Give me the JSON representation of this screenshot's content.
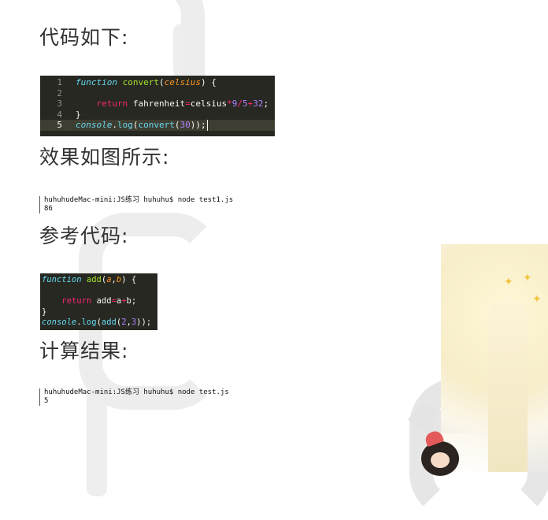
{
  "headings": {
    "code_below": "代码如下:",
    "effect": "效果如图所示:",
    "reference": "参考代码:",
    "result": "计算结果:"
  },
  "code1": {
    "line_numbers": [
      "1",
      "2",
      "3",
      "4",
      "5"
    ],
    "l1": {
      "kw": "function",
      "fn": "convert",
      "p1": "(",
      "arg": "celsius",
      "p2": ") {"
    },
    "l3": {
      "indent": "    ",
      "ret": "return",
      "a": " fahrenheit",
      "eq": "=",
      "b": "celsius",
      "op1": "*",
      "n1": "9",
      "op2": "/",
      "n2": "5",
      "op3": "+",
      "n3": "32",
      "end": ";"
    },
    "l4": {
      "text": "}"
    },
    "l5": {
      "kw": "console",
      "dot": ".",
      "fn1": "log",
      "p1": "(",
      "fn2": "convert",
      "p2": "(",
      "n": "30",
      "p3": "));"
    }
  },
  "terminal1": {
    "prompt": "huhuhudeMac-mini:JS练习 huhuhu$ node test1.js",
    "output": "86"
  },
  "code2": {
    "l1": {
      "kw": "function",
      "fn": "add",
      "p1": "(",
      "a": "a",
      "c": ",",
      "b": "b",
      "p2": ") {"
    },
    "l3": {
      "indent": "    ",
      "ret": "return",
      "a": " add",
      "eq": "=",
      "x": "a",
      "op": "+",
      "y": "b",
      "end": ";"
    },
    "l4": {
      "text": "}"
    },
    "l5": {
      "kw": "console",
      "dot": ".",
      "fn1": "log",
      "p1": "(",
      "fn2": "add",
      "p2": "(",
      "n1": "2",
      "c": ",",
      "n2": "3",
      "p3": "));"
    }
  },
  "terminal2": {
    "prompt": "huhuhudeMac-mini:JS练习 huhuhu$ node test.js",
    "output": "5"
  },
  "colors": {
    "editor_bg": "#272822",
    "keyword": "#66d9ef",
    "function": "#a6e22e",
    "argument": "#fd971f",
    "return": "#f92672",
    "number": "#ae81ff"
  }
}
